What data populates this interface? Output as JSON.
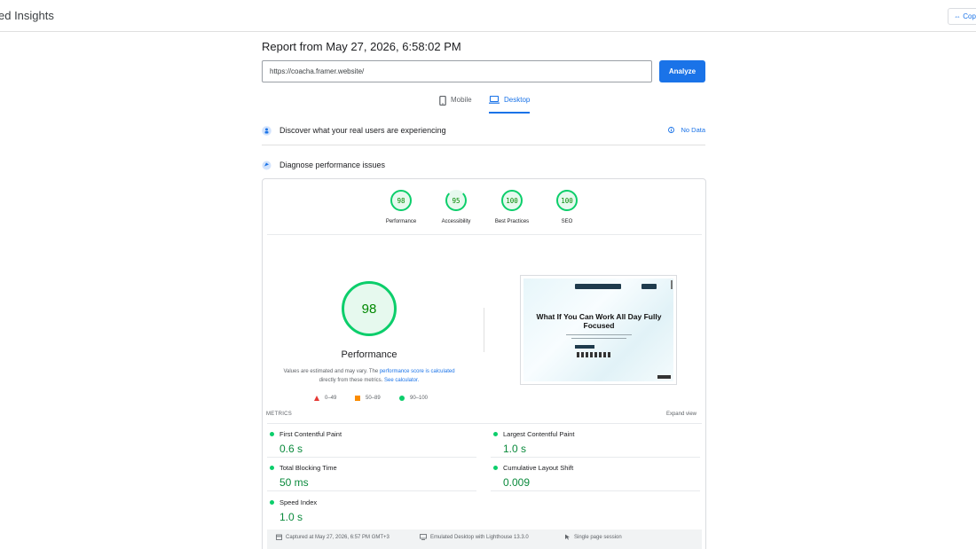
{
  "app": {
    "title": "ed Insights",
    "copy_label": "Cop"
  },
  "report": {
    "title": "Report from May 27, 2026, 6:58:02 PM",
    "url": "https://coacha.framer.website/",
    "analyze_label": "Analyze"
  },
  "tabs": [
    {
      "label": "Mobile",
      "icon": "phone-icon",
      "active": false
    },
    {
      "label": "Desktop",
      "icon": "laptop-icon",
      "active": true
    }
  ],
  "sections": {
    "crux": {
      "label": "Discover what your real users are experiencing",
      "status": "No Data"
    },
    "diagnose": {
      "label": "Diagnose performance issues"
    }
  },
  "scores": [
    {
      "value": "98",
      "label": "Performance"
    },
    {
      "value": "95",
      "label": "Accessibility"
    },
    {
      "value": "100",
      "label": "Best Practices"
    },
    {
      "value": "100",
      "label": "SEO"
    }
  ],
  "performance": {
    "score": "98",
    "title": "Performance",
    "desc_1": "Values are estimated and may vary. The ",
    "desc_link_1": "performance score is calculated",
    "desc_2": " directly from these metrics. ",
    "desc_link_2": "See calculator.",
    "legend": [
      {
        "range": "0–49",
        "color": "#e53935"
      },
      {
        "range": "50–89",
        "color": "#fb8c00"
      },
      {
        "range": "90–100",
        "color": "#0cce6b"
      }
    ]
  },
  "screenshot": {
    "headline": "What If You Can Work All Day Fully Focused"
  },
  "metrics": {
    "label": "METRICS",
    "expand_label": "Expand view",
    "items": [
      {
        "name": "First Contentful Paint",
        "value": "0.6 s"
      },
      {
        "name": "Largest Contentful Paint",
        "value": "1.0 s"
      },
      {
        "name": "Total Blocking Time",
        "value": "50 ms"
      },
      {
        "name": "Cumulative Layout Shift",
        "value": "0.009"
      },
      {
        "name": "Speed Index",
        "value": "1.0 s"
      }
    ]
  },
  "footer": {
    "captured": "Captured at May 27, 2026, 6:57 PM GMT+3",
    "emulated": "Emulated Desktop with Lighthouse 13.3.0",
    "session": "Single page session"
  }
}
